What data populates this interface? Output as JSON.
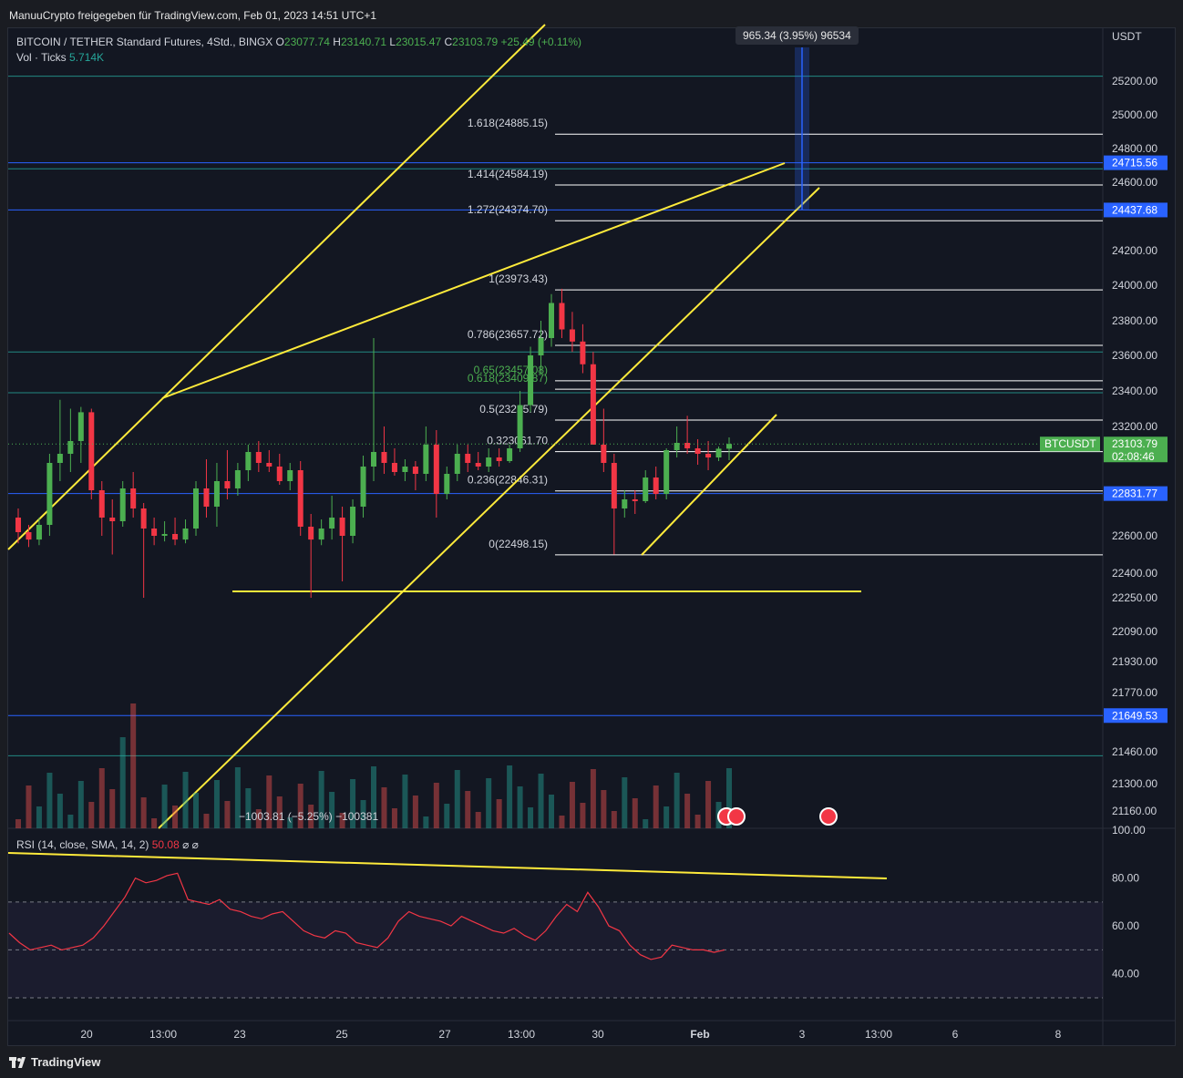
{
  "header": {
    "shared_by": "ManuuCrypto freigegeben für TradingView.com, Feb 01, 2023 14:51 UTC+1"
  },
  "legend": {
    "symbol": "BITCOIN / TETHER Standard Futures, 4Std., BINGX",
    "o_label": "O",
    "o_value": "23077.74",
    "h_label": "H",
    "h_value": "23140.71",
    "l_label": "L",
    "l_value": "23015.47",
    "c_label": "C",
    "c_value": "23103.79",
    "change": "+25.49 (+0.11%)",
    "vol_label": "Vol · Ticks",
    "vol_value": "5.714K"
  },
  "rsi_legend": {
    "label": "RSI (14, close, SMA, 14, 2)",
    "value": "50.08",
    "extra": "⌀  ⌀"
  },
  "measure_box": "965.34 (3.95%) 96534",
  "measure_down": "−1003.81 (−5.25%) −100381",
  "footer": {
    "brand": "TradingView"
  },
  "colors": {
    "up": "#4caf50",
    "down": "#f23645",
    "trendline": "#ffeb3b",
    "hline_blue": "#2962ff",
    "hline_green": "#26a69a",
    "fib_line": "#ffffff",
    "price_tag": "#4caf50"
  },
  "chart_data": [
    {
      "type": "candlestick",
      "title": "",
      "timeframe": "4h",
      "y_unit": "USDT",
      "y_scale": "custom (non-linear, TradingView log-like)",
      "y_tick_labels": [
        "25200.00",
        "25000.00",
        "24800.00",
        "24600.00",
        "24200.00",
        "24000.00",
        "23800.00",
        "23600.00",
        "23400.00",
        "23200.00",
        "22600.00",
        "22400.00",
        "22250.00",
        "22090.00",
        "21930.00",
        "21770.00",
        "21460.00",
        "21300.00",
        "21160.00"
      ],
      "x_tick_labels": [
        "20",
        "13:00",
        "23",
        "25",
        "27",
        "13:00",
        "30",
        "Feb",
        "3",
        "13:00",
        "6",
        "8"
      ],
      "price_tags": [
        {
          "label": "24715.56",
          "color": "#2962ff"
        },
        {
          "label": "24437.68",
          "color": "#2962ff"
        },
        {
          "label": "23103.79",
          "color": "#4caf50",
          "sub": "02:08:46"
        },
        {
          "label": "22831.77",
          "color": "#2962ff"
        },
        {
          "label": "21649.53",
          "color": "#2962ff"
        }
      ],
      "symbol_tag": "BTCUSDT",
      "fib_levels": [
        {
          "ratio": "1.618",
          "price": "24885.15",
          "label": "1.618(24885.15)"
        },
        {
          "ratio": "1.414",
          "price": "24584.19",
          "label": "1.414(24584.19)"
        },
        {
          "ratio": "1.272",
          "price": "24374.70",
          "label": "1.272(24374.70)"
        },
        {
          "ratio": "1",
          "price": "23973.43",
          "label": "1(23973.43)"
        },
        {
          "ratio": "0.786",
          "price": "23657.72",
          "label": "0.786(23657.72)"
        },
        {
          "ratio": "0.65",
          "price": "23457.08",
          "label": "0.65(23457.08)"
        },
        {
          "ratio": "0.618",
          "price": "23409.87",
          "label": "0.618(23409.87)"
        },
        {
          "ratio": "0.5",
          "price": "23235.79",
          "label": "0.5(23235.79)"
        },
        {
          "ratio": "0.382",
          "price": "23061.70",
          "label": "0.3​​​​​​​​​​​​23061.70"
        },
        {
          "ratio": "0.236",
          "price": "22846.31",
          "label": "0.236(22846.31)"
        },
        {
          "ratio": "0",
          "price": "22498.15",
          "label": "0(22498.15)"
        }
      ],
      "candles": [
        [
          22700,
          22750,
          22560,
          22620
        ],
        [
          22620,
          22660,
          22540,
          22580
        ],
        [
          22580,
          22700,
          22550,
          22660
        ],
        [
          22660,
          23050,
          22600,
          23000
        ],
        [
          23000,
          23350,
          22900,
          23050
        ],
        [
          23050,
          23300,
          22950,
          23120
        ],
        [
          23120,
          23310,
          23000,
          23280
        ],
        [
          23280,
          23300,
          22800,
          22850
        ],
        [
          22850,
          22900,
          22600,
          22700
        ],
        [
          22700,
          22800,
          22500,
          22680
        ],
        [
          22680,
          22900,
          22650,
          22860
        ],
        [
          22860,
          22950,
          22700,
          22750
        ],
        [
          22750,
          22780,
          22250,
          22640
        ],
        [
          22640,
          22700,
          22550,
          22600
        ],
        [
          22600,
          22680,
          22570,
          22610
        ],
        [
          22610,
          22700,
          22550,
          22580
        ],
        [
          22580,
          22690,
          22560,
          22640
        ],
        [
          22640,
          22900,
          22600,
          22860
        ],
        [
          22860,
          23020,
          22700,
          22760
        ],
        [
          22760,
          23000,
          22650,
          22900
        ],
        [
          22900,
          23070,
          22800,
          22860
        ],
        [
          22860,
          23000,
          22820,
          22960
        ],
        [
          22960,
          23100,
          22900,
          23060
        ],
        [
          23060,
          23120,
          22950,
          23000
        ],
        [
          23000,
          23070,
          22950,
          22980
        ],
        [
          22980,
          23050,
          22880,
          22900
        ],
        [
          22900,
          23000,
          22850,
          22960
        ],
        [
          22960,
          23010,
          22600,
          22650
        ],
        [
          22650,
          22720,
          22250,
          22580
        ],
        [
          22580,
          22690,
          22550,
          22640
        ],
        [
          22640,
          22820,
          22580,
          22700
        ],
        [
          22700,
          22760,
          22350,
          22600
        ],
        [
          22600,
          22800,
          22560,
          22760
        ],
        [
          22760,
          23040,
          22700,
          22980
        ],
        [
          22980,
          23700,
          22900,
          23060
        ],
        [
          23060,
          23200,
          22940,
          23000
        ],
        [
          23000,
          23080,
          22930,
          22950
        ],
        [
          22950,
          23020,
          22900,
          22980
        ],
        [
          22980,
          23010,
          22850,
          22940
        ],
        [
          22940,
          23200,
          22900,
          23100
        ],
        [
          23100,
          23180,
          22700,
          22830
        ],
        [
          22830,
          22980,
          22800,
          22940
        ],
        [
          22940,
          23100,
          22900,
          23050
        ],
        [
          23050,
          23100,
          22950,
          23000
        ],
        [
          23000,
          23060,
          22960,
          22980
        ],
        [
          22980,
          23080,
          22950,
          23030
        ],
        [
          23030,
          23080,
          22980,
          23010
        ],
        [
          23010,
          23100,
          23000,
          23080
        ],
        [
          23080,
          23400,
          23060,
          23320
        ],
        [
          23320,
          23650,
          23280,
          23600
        ],
        [
          23600,
          23800,
          23500,
          23700
        ],
        [
          23700,
          23950,
          23650,
          23900
        ],
        [
          23900,
          23980,
          23700,
          23750
        ],
        [
          23750,
          23850,
          23620,
          23680
        ],
        [
          23680,
          23780,
          23500,
          23550
        ],
        [
          23550,
          23620,
          23200,
          23100
        ],
        [
          23100,
          23300,
          22950,
          23000
        ],
        [
          23000,
          23050,
          22500,
          22750
        ],
        [
          22750,
          22850,
          22700,
          22800
        ],
        [
          22800,
          22850,
          22720,
          22790
        ],
        [
          22790,
          22960,
          22780,
          22920
        ],
        [
          22920,
          22980,
          22800,
          22830
        ],
        [
          22830,
          23080,
          22800,
          23070
        ],
        [
          23070,
          23200,
          23030,
          23110
        ],
        [
          23110,
          23260,
          23050,
          23080
        ],
        [
          23080,
          23130,
          22990,
          23050
        ],
        [
          23050,
          23120,
          22960,
          23030
        ],
        [
          23030,
          23090,
          23010,
          23078
        ],
        [
          23078,
          23140,
          23015,
          23104
        ]
      ]
    },
    {
      "type": "line",
      "title": "",
      "indicator": "RSI",
      "ylim": [
        30,
        100
      ],
      "y_tick_labels": [
        "100.00",
        "80.00",
        "60.00",
        "40.00"
      ],
      "band": [
        30,
        70
      ],
      "midline": 50,
      "values": [
        57,
        53,
        50,
        51,
        52,
        50,
        51,
        52,
        55,
        60,
        66,
        72,
        80,
        78,
        79,
        81,
        82,
        71,
        70,
        69,
        71,
        67,
        66,
        64,
        63,
        65,
        66,
        62,
        58,
        56,
        55,
        58,
        57,
        53,
        52,
        51,
        55,
        62,
        66,
        64,
        63,
        62,
        60,
        64,
        62,
        60,
        58,
        57,
        59,
        56,
        54,
        58,
        64,
        69,
        66,
        74,
        68,
        60,
        58,
        52,
        48,
        46,
        47,
        52,
        51,
        50,
        50,
        49,
        50
      ]
    }
  ]
}
